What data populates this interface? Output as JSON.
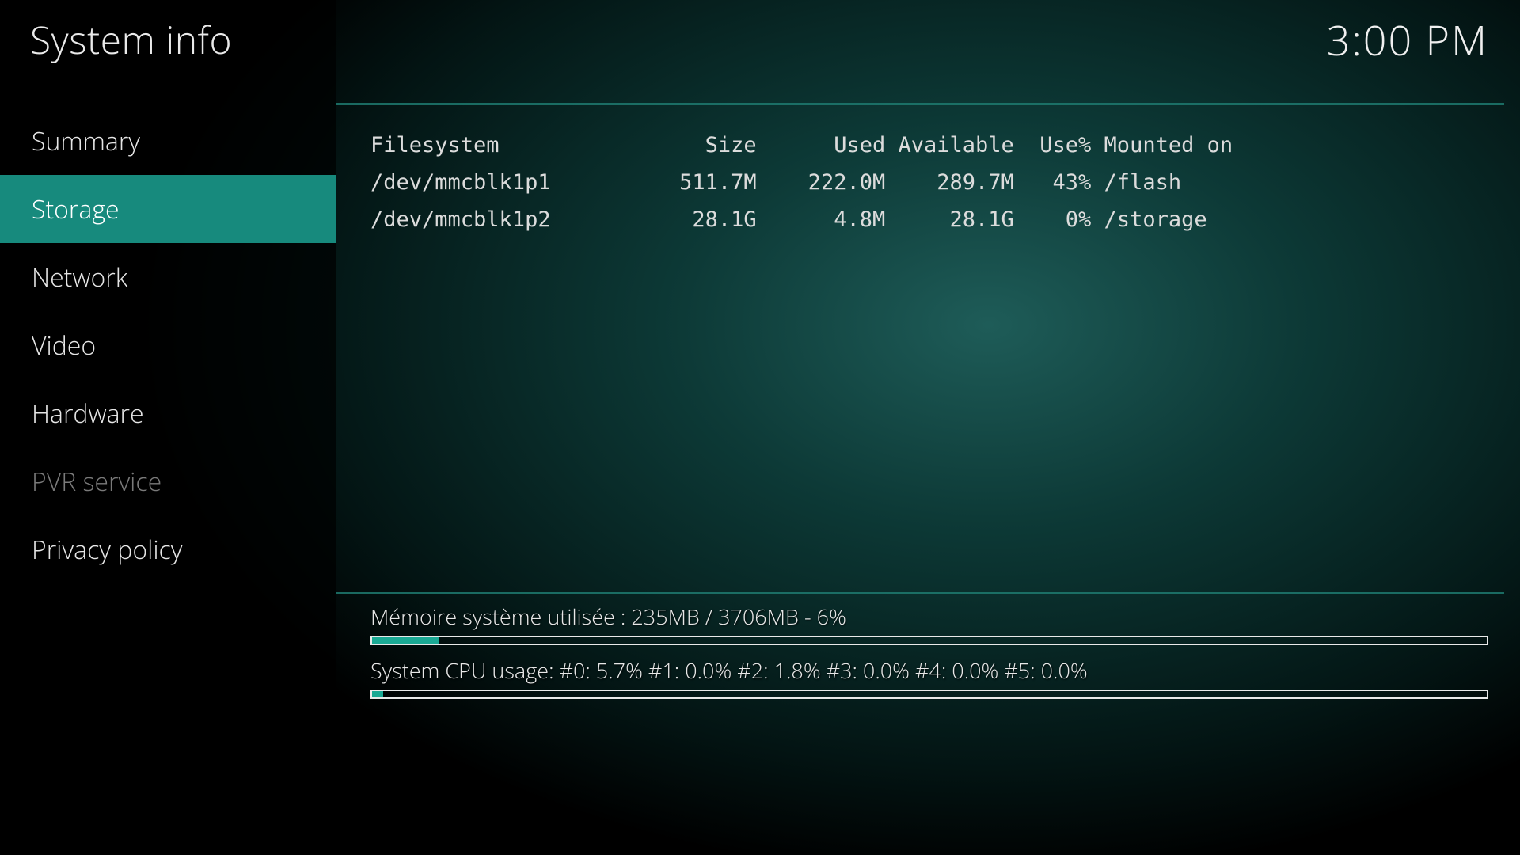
{
  "header": {
    "title": "System info",
    "clock": "3:00 PM"
  },
  "sidebar": {
    "items": [
      {
        "label": "Summary",
        "selected": false,
        "disabled": false
      },
      {
        "label": "Storage",
        "selected": true,
        "disabled": false
      },
      {
        "label": "Network",
        "selected": false,
        "disabled": false
      },
      {
        "label": "Video",
        "selected": false,
        "disabled": false
      },
      {
        "label": "Hardware",
        "selected": false,
        "disabled": false
      },
      {
        "label": "PVR service",
        "selected": false,
        "disabled": true
      },
      {
        "label": "Privacy policy",
        "selected": false,
        "disabled": false
      }
    ]
  },
  "storage": {
    "header": {
      "fs": "Filesystem",
      "size": "Size",
      "used": "Used",
      "avail": "Available",
      "pct": "Use%",
      "mount": "Mounted on"
    },
    "rows": [
      {
        "fs": "/dev/mmcblk1p1",
        "size": "511.7M",
        "used": "222.0M",
        "avail": "289.7M",
        "pct": "43%",
        "mount": "/flash"
      },
      {
        "fs": "/dev/mmcblk1p2",
        "size": "28.1G",
        "used": "4.8M",
        "avail": "28.1G",
        "pct": "0%",
        "mount": "/storage"
      }
    ]
  },
  "status": {
    "memory": {
      "text": "Mémoire système utilisée : 235MB / 3706MB - 6%",
      "percent": 6
    },
    "cpu": {
      "text": "System CPU usage: #0: 5.7% #1: 0.0% #2: 1.8% #3: 0.0% #4: 0.0% #5: 0.0%",
      "percent": 1
    }
  }
}
